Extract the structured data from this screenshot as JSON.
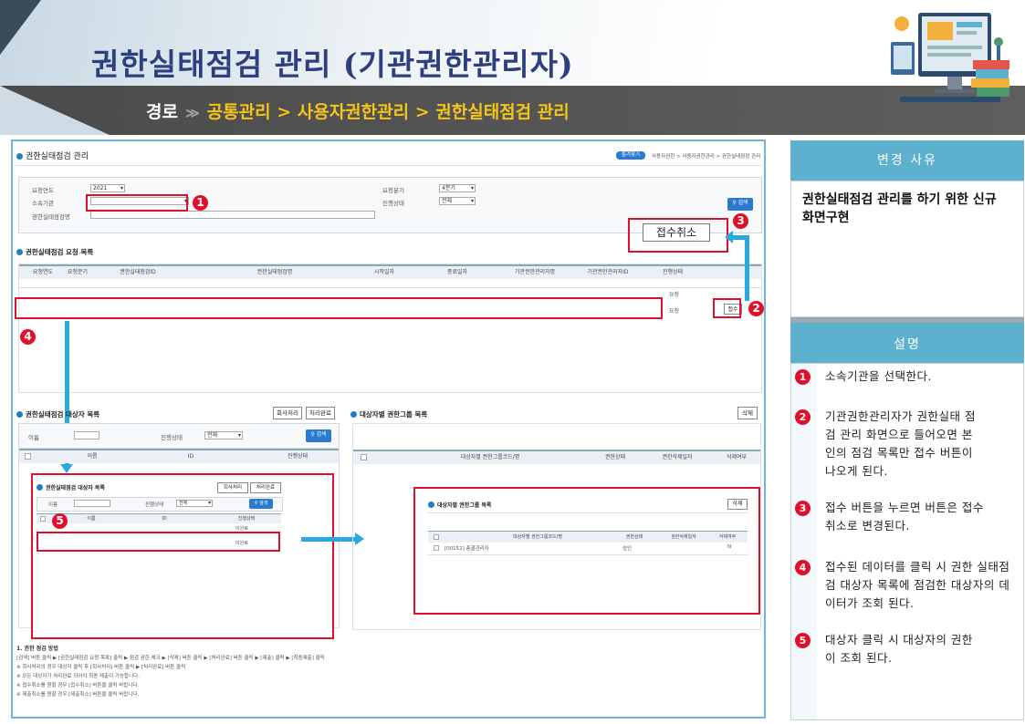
{
  "header": {
    "title": "권한실태점검 관리 (기관권한관리자)",
    "breadcrumb_label": "경로",
    "breadcrumb_arrow": "≫",
    "breadcrumb_path": "공통관리 > 사용자권한관리 > 권한실태점검 관리"
  },
  "screen": {
    "page_title": "권한실태점검 관리",
    "top_right": {
      "badge": "즐겨찾기",
      "crumbs": "사용자권한 > 사용자권한관리 > 권한실태점검 관리"
    },
    "filters": {
      "year_label": "요청연도",
      "year_value": "2021",
      "org_label": "소속기관",
      "check_name_label": "권한실태점검명",
      "quarter_label": "요청분기",
      "quarter_value": "4분기",
      "status_label": "진행상태",
      "status_value": "전체",
      "search_button": "검색"
    },
    "cancel_receipt_button": "접수취소",
    "request_list": {
      "title": "권한실태점검 요청 목록",
      "columns": [
        "요청연도",
        "요청분기",
        "권한실태점검ID",
        "권한실태점검명",
        "시작일자",
        "종료일자",
        "기관권한관리자명",
        "기관권한관리자ID",
        "진행상태"
      ],
      "row1_status": "요청",
      "row2_status": "요청",
      "receive_button": "접수"
    },
    "target_list": {
      "title": "권한실태점검 대상자 목록",
      "btn_recall": "회사처리",
      "btn_done": "처리완료",
      "name_label": "이름",
      "status_label": "진행상태",
      "status_value": "전체",
      "search_button": "검색",
      "columns": [
        "이름",
        "ID",
        "진행상태"
      ]
    },
    "group_list": {
      "title": "대상자별 권한그룹 목록",
      "delete_button": "삭제",
      "columns": [
        "대상자별 권한그룹코드/명",
        "권한상태",
        "권한삭제일자",
        "삭제여부"
      ]
    },
    "inset_target": {
      "title": "권한실태점검 대상자 목록",
      "btn_recall": "회사처리",
      "btn_done": "처리완료",
      "name_label": "이름",
      "status_label": "진행상태",
      "status_value": "전체",
      "search_button": "검색",
      "columns": [
        "이름",
        "ID",
        "진행상태"
      ],
      "row1_status": "미완료",
      "row2_status": "미완료"
    },
    "inset_group": {
      "title": "대상자별 권한그룹 목록",
      "delete_button": "삭제",
      "columns": [
        "대상자별 권한그룹코드/명",
        "권한상태",
        "권한삭제일자",
        "삭제여부"
      ],
      "row_code": "[00152] 총괄관리자",
      "row_status": "승인",
      "row_deleted": "N"
    },
    "guide": {
      "heading": "1. 권한 점검 방법",
      "lines": [
        "[검색] 버튼 클릭 ▶ [권한실태점검 요청 목록] 클릭 ▶ 점검 권한 체크 ▶ [삭제] 버튼 클릭 ▶ [처리완료] 버튼 클릭 ▶ [제출] 클릭 ▶ [최종제출] 클릭",
        "※ 회사처리의 경우 대상자 클릭 후 [회사처리] 버튼 클릭 ▶ [처리완료] 버튼 클릭",
        "※ 모든 대상자가 처리완료 되어야 최종 제출이 가능합니다.",
        "※ 접수취소를 원할 경우 [접수취소] 버튼을 클릭 바랍니다.",
        "※ 제출취소를 원할 경우 [제출취소] 버튼을 클릭 바랍니다."
      ]
    },
    "markers": [
      "1",
      "2",
      "3",
      "4",
      "5"
    ]
  },
  "panel": {
    "reason_title": "변경 사유",
    "reason_text": "권한실태점검 관리를 하기 위한 신규 화면구현",
    "desc_title": "설명",
    "notes": [
      {
        "num": "1",
        "text": "소속기관을 선택한다."
      },
      {
        "num": "2",
        "text": "기관권한관리자가 권한실태 점검 관리 화면으로 들어오면 본인의 점검 목록만 접수 버튼이 나오게 된다."
      },
      {
        "num": "3",
        "text": "접수 버튼을 누르면 버튼은 접수 취소로 변경된다."
      },
      {
        "num": "4",
        "text": "접수된 데이터를 클릭 시 권한 실태점검 대상자 목록에 점검한 대상자의 데이터가 조회 된다."
      },
      {
        "num": "5",
        "text": "대상자 클릭 시 대상자의 권한이 조회 된다."
      }
    ]
  },
  "colors": {
    "title": "#2d3f7f",
    "path": "#f5c518",
    "accent_blue": "#2aa8e0",
    "marker_red": "#e0102a",
    "panel_head": "#5eb0cf"
  },
  "icons": [
    "computer-illustration-icon",
    "search-icon",
    "chevron-down-icon"
  ]
}
